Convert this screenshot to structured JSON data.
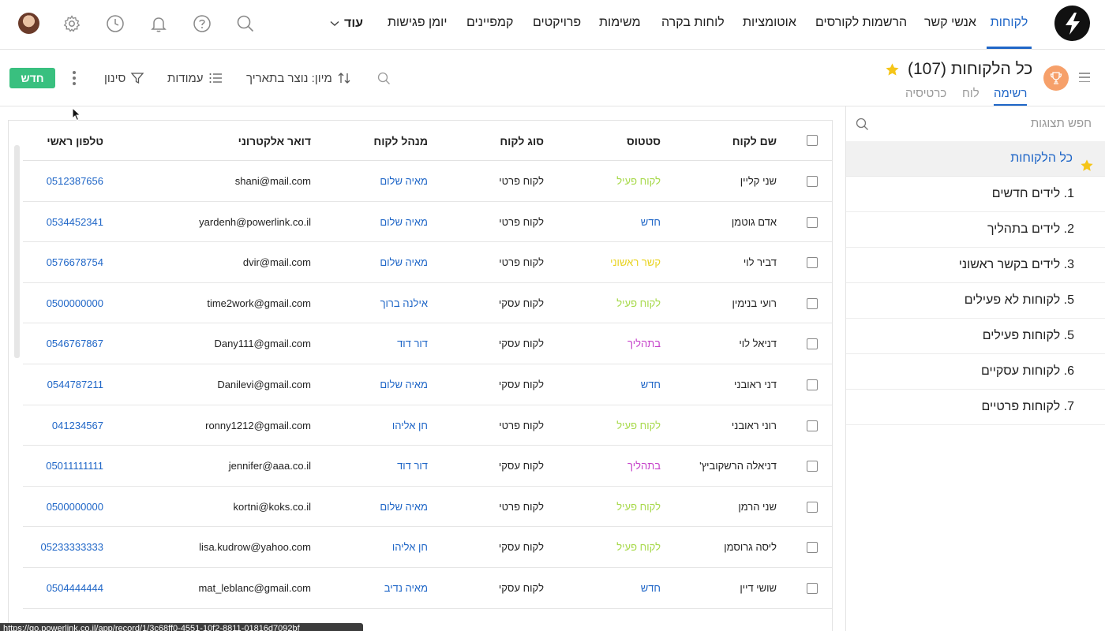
{
  "nav": {
    "items": [
      {
        "label": "לקוחות",
        "active": true
      },
      {
        "label": "אנשי קשר"
      },
      {
        "label": "הרשמות לקורסים"
      },
      {
        "label": "אוטומציות"
      },
      {
        "label": "לוחות בקרה"
      },
      {
        "label": "משימות"
      },
      {
        "label": "פרויקטים"
      },
      {
        "label": "קמפיינים"
      },
      {
        "label": "יומן פגישות"
      }
    ],
    "more_label": "עוד"
  },
  "toolbar": {
    "new_label": "חדש",
    "filter_label": "סינון",
    "columns_label": "עמודות",
    "sort_label": "מיון: נוצר בתאריך"
  },
  "view": {
    "title": "כל הלקוחות",
    "count": "(107)",
    "tabs": [
      {
        "label": "רשימה",
        "active": true
      },
      {
        "label": "לוח"
      },
      {
        "label": "כרטיסיה"
      }
    ]
  },
  "sidebar": {
    "search_placeholder": "חפש תצוגות",
    "items": [
      {
        "label": "כל הלקוחות",
        "active": true,
        "starred": true
      },
      {
        "label": "1. לידים חדשים"
      },
      {
        "label": "2. לידים בתהליך"
      },
      {
        "label": "3. לידים בקשר ראשוני"
      },
      {
        "label": "5. לקוחות לא פעילים"
      },
      {
        "label": "5. לקוחות פעילים"
      },
      {
        "label": "6. לקוחות עסקיים"
      },
      {
        "label": "7. לקוחות פרטיים"
      }
    ]
  },
  "table": {
    "headers": {
      "name": "שם לקוח",
      "status": "סטטוס",
      "type": "סוג לקוח",
      "manager": "מנהל לקוח",
      "email": "דואר אלקטרוני",
      "phone": "טלפון ראשי"
    },
    "rows": [
      {
        "name": "שני קליין",
        "status": "לקוח פעיל",
        "status_color": "#a7d94a",
        "type": "לקוח פרטי",
        "manager": "מאיה שלום",
        "email": "shani@mail.com",
        "phone": "0512387656"
      },
      {
        "name": "אדם גוטמן",
        "status": "חדש",
        "status_color": "#1f66c7",
        "type": "לקוח פרטי",
        "manager": "מאיה שלום",
        "email": "yardenh@powerlink.co.il",
        "phone": "0534452341"
      },
      {
        "name": "דביר לוי",
        "status": "קשר ראשוני",
        "status_color": "#e8d21d",
        "type": "לקוח פרטי",
        "manager": "מאיה שלום",
        "email": "dvir@mail.com",
        "phone": "0576678754"
      },
      {
        "name": "רועי בנימין",
        "status": "לקוח פעיל",
        "status_color": "#a7d94a",
        "type": "לקוח עסקי",
        "manager": "אילנה ברוך",
        "email": "time2work@gmail.com",
        "phone": "0500000000"
      },
      {
        "name": "דניאל לוי",
        "status": "בתהליך",
        "status_color": "#c53fc9",
        "type": "לקוח עסקי",
        "manager": "דור דוד",
        "email": "Dany111@gmail.com",
        "phone": "0546767867"
      },
      {
        "name": "דני ראובני",
        "status": "חדש",
        "status_color": "#1f66c7",
        "type": "לקוח עסקי",
        "manager": "מאיה שלום",
        "email": "Danilevi@gmail.com",
        "phone": "0544787211"
      },
      {
        "name": "רוני ראובני",
        "status": "לקוח פעיל",
        "status_color": "#a7d94a",
        "type": "לקוח פרטי",
        "manager": "חן אליהו",
        "email": "ronny1212@gmail.com",
        "phone": "041234567"
      },
      {
        "name": "דניאלה הרשקוביץ'",
        "status": "בתהליך",
        "status_color": "#c53fc9",
        "type": "לקוח עסקי",
        "manager": "דור דוד",
        "email": "jennifer@aaa.co.il",
        "phone": "05011111111"
      },
      {
        "name": "שני הרמן",
        "status": "לקוח פעיל",
        "status_color": "#a7d94a",
        "type": "לקוח פרטי",
        "manager": "מאיה שלום",
        "email": "kortni@koks.co.il",
        "phone": "0500000000"
      },
      {
        "name": "ליסה גרוסמן",
        "status": "לקוח פעיל",
        "status_color": "#a7d94a",
        "type": "לקוח עסקי",
        "manager": "חן אליהו",
        "email": "lisa.kudrow@yahoo.com",
        "phone": "05233333333"
      },
      {
        "name": "שושי דיין",
        "status": "חדש",
        "status_color": "#1f66c7",
        "type": "לקוח עסקי",
        "manager": "מאיה נדיב",
        "email": "mat_leblanc@gmail.com",
        "phone": "0504444444"
      }
    ]
  },
  "statusbar": {
    "url": "https://go.powerlink.co.il/app/record/1/3c68ff0-4551-10f2-8811-01816d7092bf"
  }
}
